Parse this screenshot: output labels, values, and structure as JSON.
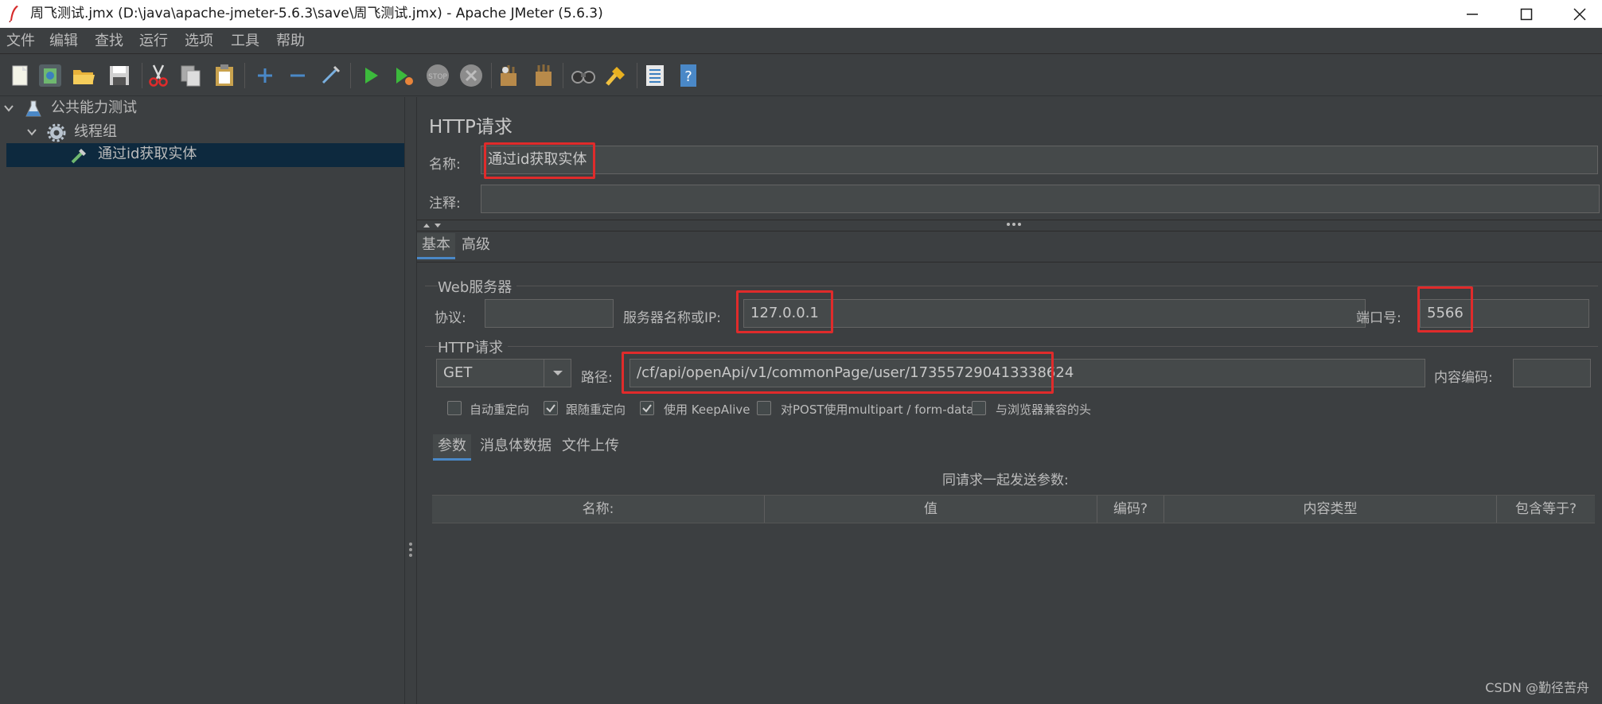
{
  "window": {
    "title": "周飞测试.jmx (D:\\java\\apache-jmeter-5.6.3\\save\\周飞测试.jmx) - Apache JMeter (5.6.3)"
  },
  "menu": [
    "文件",
    "编辑",
    "查找",
    "运行",
    "选项",
    "工具",
    "帮助"
  ],
  "toolbar_icons": [
    "new-icon",
    "templates-icon",
    "open-icon",
    "save-icon",
    "cut-icon",
    "copy-icon",
    "paste-icon",
    "expand-icon",
    "collapse-icon",
    "toggle-icon",
    "start-icon",
    "start-no-pause-icon",
    "stop-icon",
    "shutdown-icon",
    "clear-icon",
    "clear-all-icon",
    "search-icon",
    "reset-search-icon",
    "function-helper-icon",
    "help-icon"
  ],
  "tree": {
    "plan": "公共能力测试",
    "thread_group": "线程组",
    "sampler": "通过id获取实体"
  },
  "panel": {
    "title": "HTTP请求",
    "name_label": "名称:",
    "name_value": "通过id获取实体",
    "comment_label": "注释:",
    "comment_value": ""
  },
  "tabs": {
    "basic": "基本",
    "advanced": "高级"
  },
  "web_server": {
    "group_title": "Web服务器",
    "protocol_label": "协议:",
    "protocol_value": "",
    "server_label": "服务器名称或IP:",
    "server_value": "127.0.0.1",
    "port_label": "端口号:",
    "port_value": "5566"
  },
  "http_request": {
    "group_title": "HTTP请求",
    "method": "GET",
    "path_label": "路径:",
    "path_value": "/cf/api/openApi/v1/commonPage/user/173557290413338624",
    "encoding_label": "内容编码:",
    "encoding_value": ""
  },
  "checkboxes": [
    {
      "label": "自动重定向",
      "checked": false
    },
    {
      "label": "跟随重定向",
      "checked": true
    },
    {
      "label": "使用 KeepAlive",
      "checked": true
    },
    {
      "label": "对POST使用multipart / form-data",
      "checked": false
    },
    {
      "label": "与浏览器兼容的头",
      "checked": false
    }
  ],
  "sub_tabs": {
    "params": "参数",
    "body": "消息体数据",
    "files": "文件上传"
  },
  "params_table": {
    "caption": "同请求一起发送参数:",
    "columns": [
      "名称:",
      "值",
      "编码?",
      "内容类型",
      "包含等于?"
    ]
  },
  "watermark": "CSDN @勤径苦舟",
  "colors": {
    "background": "#3c3f41",
    "highlight_box": "#e02b2b",
    "selection": "#0d293e",
    "tab_accent": "#4a88c7"
  }
}
